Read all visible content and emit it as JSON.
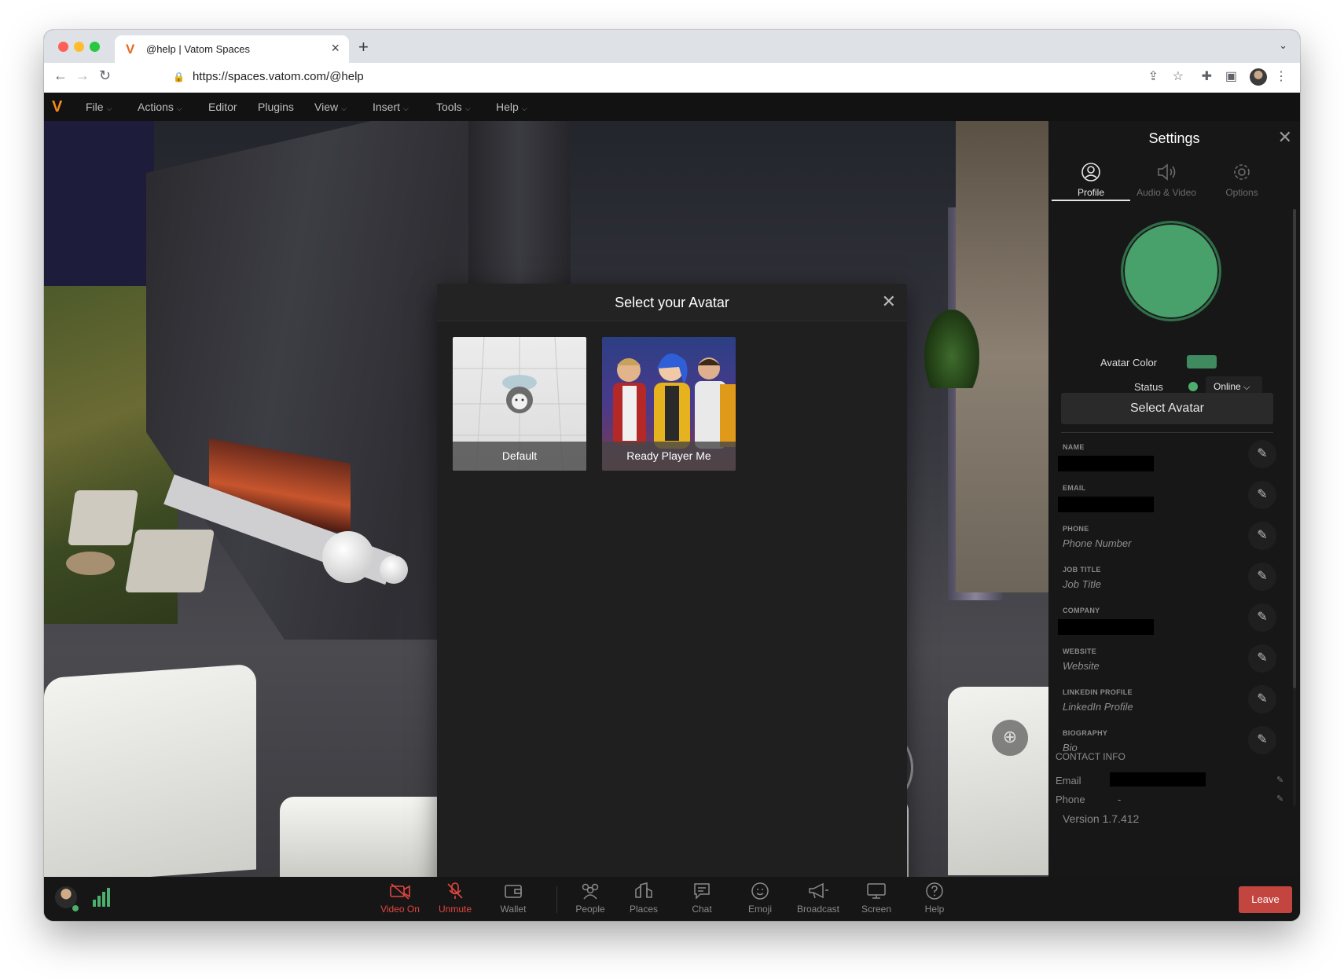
{
  "browser": {
    "tab_title": "@help | Vatom Spaces",
    "url": "https://spaces.vatom.com/@help"
  },
  "menu": {
    "items": [
      {
        "label": "File",
        "has_dropdown": true
      },
      {
        "label": "Actions",
        "has_dropdown": true
      },
      {
        "label": "Editor",
        "has_dropdown": false
      },
      {
        "label": "Plugins",
        "has_dropdown": false
      },
      {
        "label": "View",
        "has_dropdown": true
      },
      {
        "label": "Insert",
        "has_dropdown": true
      },
      {
        "label": "Tools",
        "has_dropdown": true
      },
      {
        "label": "Help",
        "has_dropdown": true
      }
    ]
  },
  "avatar_modal": {
    "title": "Select your Avatar",
    "options": [
      {
        "label": "Default"
      },
      {
        "label": "Ready Player Me"
      }
    ]
  },
  "settings": {
    "title": "Settings",
    "tabs": [
      {
        "label": "Profile",
        "active": true,
        "icon": "user-icon"
      },
      {
        "label": "Audio & Video",
        "active": false,
        "icon": "speaker-icon"
      },
      {
        "label": "Options",
        "active": false,
        "icon": "gear-icon"
      }
    ],
    "avatar_color_label": "Avatar Color",
    "avatar_color": "#48a06a",
    "status_label": "Status",
    "status_value": "Online",
    "select_avatar_label": "Select Avatar",
    "fields": [
      {
        "label": "NAME",
        "value": "",
        "redacted": true
      },
      {
        "label": "EMAIL",
        "value": "",
        "redacted": true
      },
      {
        "label": "PHONE",
        "value": "Phone Number",
        "redacted": false
      },
      {
        "label": "JOB TITLE",
        "value": "Job Title",
        "redacted": false
      },
      {
        "label": "COMPANY",
        "value": "",
        "redacted": true
      },
      {
        "label": "WEBSITE",
        "value": "Website",
        "redacted": false
      },
      {
        "label": "LINKEDIN PROFILE",
        "value": "LinkedIn Profile",
        "redacted": false
      },
      {
        "label": "BIOGRAPHY",
        "value": "Bio",
        "redacted": false
      }
    ],
    "contact_info": {
      "heading": "CONTACT INFO",
      "email_label": "Email",
      "phone_label": "Phone",
      "phone_value": "-"
    },
    "version": "Version 1.7.412"
  },
  "bottom_bar": {
    "buttons": [
      {
        "label": "Video On",
        "icon": "video-off-icon",
        "state": "off"
      },
      {
        "label": "Unmute",
        "icon": "mic-off-icon",
        "state": "off"
      },
      {
        "label": "Wallet",
        "icon": "wallet-icon",
        "state": "normal"
      },
      {
        "label": "People",
        "icon": "people-icon",
        "state": "normal"
      },
      {
        "label": "Places",
        "icon": "places-icon",
        "state": "normal"
      },
      {
        "label": "Chat",
        "icon": "chat-icon",
        "state": "normal"
      },
      {
        "label": "Emoji",
        "icon": "emoji-icon",
        "state": "normal"
      },
      {
        "label": "Broadcast",
        "icon": "megaphone-icon",
        "state": "normal"
      },
      {
        "label": "Screen",
        "icon": "screen-icon",
        "state": "normal"
      },
      {
        "label": "Help",
        "icon": "help-icon",
        "state": "normal"
      }
    ],
    "leave_label": "Leave"
  },
  "colors": {
    "accent_red": "#e2463f",
    "leave_red": "#c2463f",
    "brand_orange": "#f4891f",
    "online_green": "#4caf6e"
  }
}
